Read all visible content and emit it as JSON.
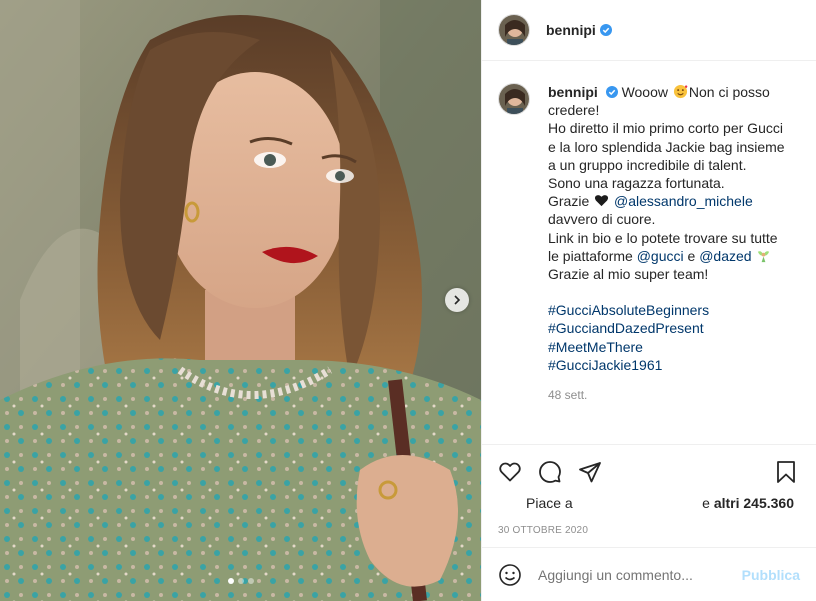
{
  "post": {
    "username": "bennipi",
    "verified": true,
    "carousel_active_index": 0,
    "carousel_count": 3
  },
  "caption": {
    "username": "bennipi",
    "lines": [
      "Wooow",
      "Non ci posso",
      "credere!",
      "Ho diretto il mio primo corto per Gucci",
      "e la loro splendida Jackie bag insieme",
      "a un gruppo incredibile di talent.",
      "Sono una ragazza fortunata.",
      "Grazie",
      "@alessandro_michele",
      "davvero di cuore.",
      "Link in bio e lo potete trovare su tutte",
      "le piattaforme",
      "@gucci",
      "e",
      "@dazed",
      "Grazie al mio super team!"
    ],
    "hashtags": [
      "#GucciAbsoluteBeginners",
      "#GucciandDazedPresent",
      "#MeetMeThere",
      "#GucciJackie1961"
    ],
    "time_ago": "48 sett."
  },
  "likes": {
    "left": "Piace a",
    "right_prefix": "e",
    "right_count": "altri 245.360"
  },
  "date": "30 OTTOBRE 2020",
  "comment_box": {
    "placeholder": "Aggiungi un commento...",
    "publish": "Pubblica"
  },
  "icons": {
    "like": "heart-icon",
    "comment": "comment-bubble-icon",
    "share": "paper-plane-icon",
    "save": "bookmark-icon",
    "next": "chevron-right-icon",
    "emoji": "smiley-icon",
    "verified": "verified-badge-icon"
  },
  "colors": {
    "link": "#00376b",
    "verified": "#3897f0",
    "muted": "#8e8e8e",
    "publish_disabled": "#b2dffc"
  }
}
